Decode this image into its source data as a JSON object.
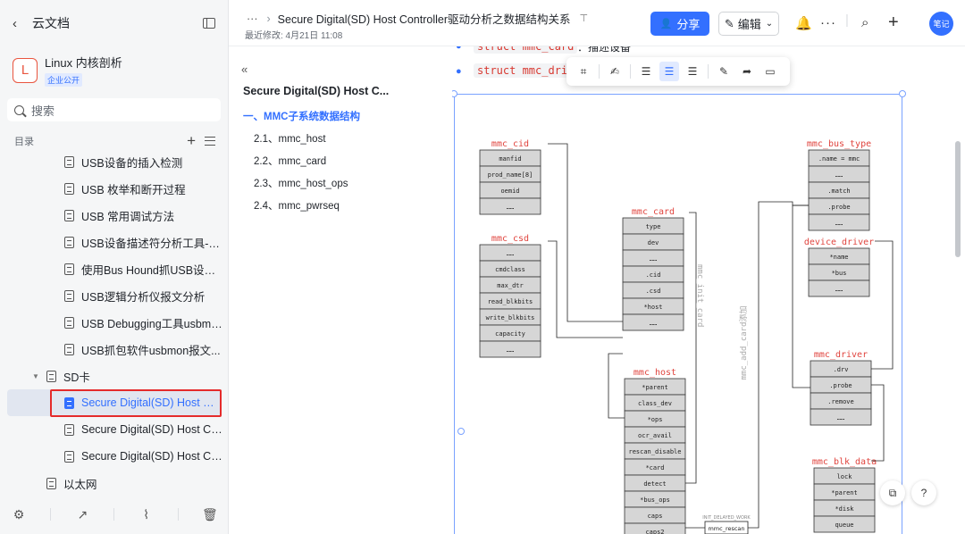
{
  "sidebar": {
    "back_label": "云文档",
    "workspace": {
      "logo_letter": "L",
      "name": "Linux 内核剖析",
      "badge": "企业公开"
    },
    "search_placeholder": "搜索",
    "toc_label": "目录",
    "items": [
      {
        "label": "USB设备的插入检测"
      },
      {
        "label": "USB 枚举和断开过程"
      },
      {
        "label": "USB 常用调试方法"
      },
      {
        "label": "USB设备描述符分析工具-U..."
      },
      {
        "label": "使用Bus Hound抓USB设备..."
      },
      {
        "label": "USB逻辑分析仪报文分析"
      },
      {
        "label": "USB Debugging工具usbmo..."
      },
      {
        "label": "USB抓包软件usbmon报文..."
      },
      {
        "label": "SD卡",
        "folder": true
      },
      {
        "label": "Secure Digital(SD) Host Co...",
        "selected": true
      },
      {
        "label": "Secure Digital(SD) Host Co..."
      },
      {
        "label": "Secure Digital(SD) Host Co..."
      },
      {
        "label": "以太网",
        "folder": true
      }
    ]
  },
  "header": {
    "breadcrumb_title": "Secure Digital(SD) Host Controller驱动分析之数据结构关系",
    "modified": "最近修改: 4月21日 11:08",
    "share_label": "分享",
    "edit_label": "编辑",
    "avatar_label": "笔记"
  },
  "outline": {
    "title": "Secure Digital(SD) Host C...",
    "items": [
      {
        "label": "一、MMC子系统数据结构",
        "level": 1
      },
      {
        "label": "2.1、mmc_host",
        "level": 2
      },
      {
        "label": "2.2、mmc_card",
        "level": 2
      },
      {
        "label": "2.3、mmc_host_ops",
        "level": 2
      },
      {
        "label": "2.4、mmc_pwrseq",
        "level": 2
      }
    ]
  },
  "content": {
    "bullets": [
      {
        "code": "struct mmc_card",
        "tail": "：描述设备"
      },
      {
        "code": "struct mmc_dri"
      }
    ]
  },
  "diagram": {
    "boxes": {
      "mmc_cid": {
        "title": "mmc_cid",
        "fields": [
          "manfid",
          "prod_name[8]",
          "oemid",
          "……"
        ]
      },
      "mmc_csd": {
        "title": "mmc_csd",
        "fields": [
          "……",
          "cmdclass",
          "max_dtr",
          "read_blkbits",
          "write_blkbits",
          "capacity",
          "……"
        ]
      },
      "mmc_card": {
        "title": "mmc_card",
        "fields": [
          "type",
          "dev",
          "……",
          ".cid",
          ".csd",
          "*host",
          "……"
        ]
      },
      "mmc_host": {
        "title": "mmc_host",
        "fields": [
          "*parent",
          "class_dev",
          "*ops",
          "ocr_avail",
          "rescan_disable",
          "*card",
          "detect",
          "*bus_ops",
          "caps",
          "caps2"
        ]
      },
      "mmc_bus_type": {
        "title": "mmc_bus_type",
        "fields": [
          ".name = mmc",
          "……",
          ".match",
          ".probe",
          "……"
        ]
      },
      "device_driver": {
        "title": "device_driver",
        "fields": [
          "*name",
          "*bus",
          "……"
        ]
      },
      "mmc_driver": {
        "title": "mmc_driver",
        "fields": [
          ".drv",
          ".probe",
          ".remove",
          "……"
        ]
      },
      "mmc_blk_data": {
        "title": "mmc_blk_data",
        "fields": [
          "lock",
          "*parent",
          "*disk",
          "queue"
        ]
      }
    },
    "labels": {
      "mmc_init_card": "mmc_init_card",
      "mmc_add_card": "mmc_add_card添加",
      "mmc_rescan": "mmc_rescan",
      "rescan_note": "INIT_DELAYED_WORK"
    }
  },
  "colors": {
    "accent": "#3370ff",
    "highlight_box": "#e52b2b",
    "diagram_title": "#e0443e"
  }
}
